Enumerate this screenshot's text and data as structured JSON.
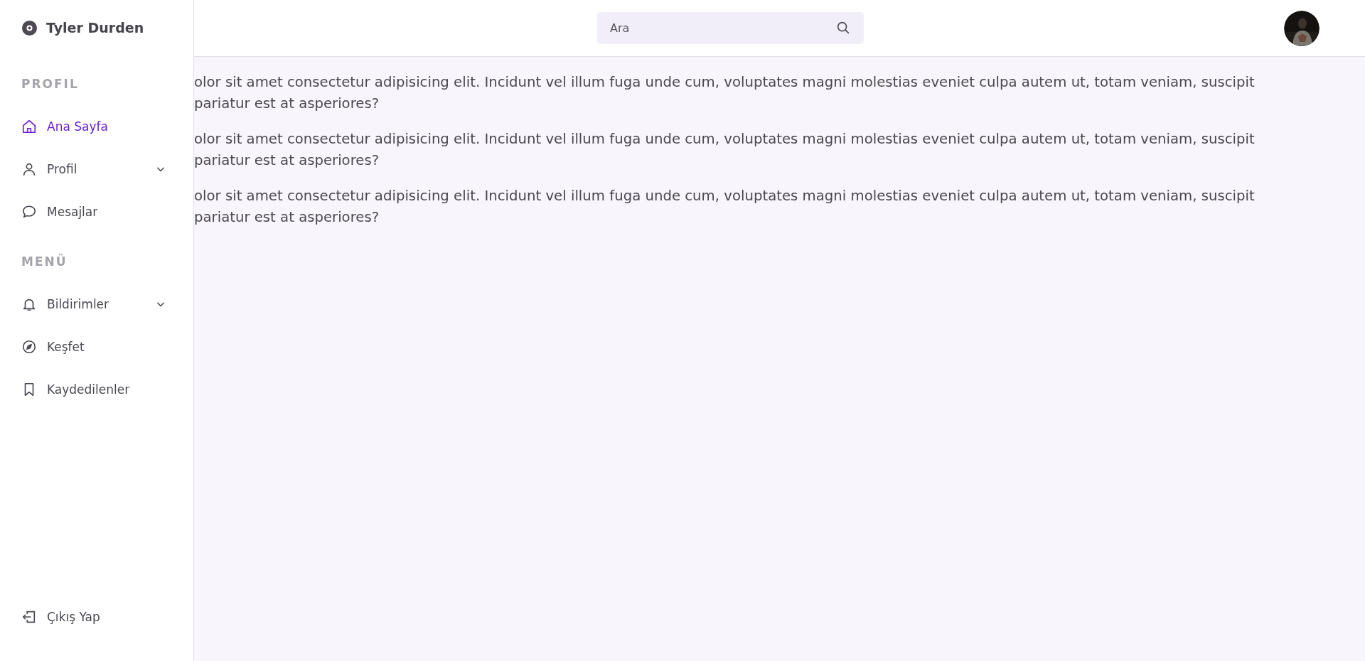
{
  "brand": {
    "title": "Tyler Durden"
  },
  "sidebar": {
    "sections": [
      {
        "heading": "PROFIL",
        "items": [
          {
            "label": "Ana Sayfa",
            "kind": "home",
            "selected": true,
            "expandable": false
          },
          {
            "label": "Profil",
            "kind": "user",
            "selected": false,
            "expandable": true
          },
          {
            "label": "Mesajlar",
            "kind": "chat",
            "selected": false,
            "expandable": false
          }
        ]
      },
      {
        "heading": "MENÜ",
        "items": [
          {
            "label": "Bildirimler",
            "kind": "bell",
            "selected": false,
            "expandable": true
          },
          {
            "label": "Keşfet",
            "kind": "compass",
            "selected": false,
            "expandable": false
          },
          {
            "label": "Kaydedilenler",
            "kind": "bookmark",
            "selected": false,
            "expandable": false
          }
        ]
      }
    ],
    "footer": {
      "label": "Çıkış Yap",
      "kind": "logout"
    }
  },
  "search": {
    "placeholder": "Ara"
  },
  "content": {
    "paragraphs": [
      {
        "lines": [
          "olor sit amet consectetur adipisicing elit. Incidunt vel illum fuga unde cum, voluptates magni molestias eveniet culpa autem ut, totam veniam, suscipit",
          "pariatur est at asperiores?"
        ]
      },
      {
        "lines": [
          "olor sit amet consectetur adipisicing elit. Incidunt vel illum fuga unde cum, voluptates magni molestias eveniet culpa autem ut, totam veniam, suscipit",
          "pariatur est at asperiores?"
        ]
      },
      {
        "lines": [
          "olor sit amet consectetur adipisicing elit. Incidunt vel illum fuga unde cum, voluptates magni molestias eveniet culpa autem ut, totam veniam, suscipit",
          "pariatur est at asperiores?"
        ]
      }
    ]
  }
}
